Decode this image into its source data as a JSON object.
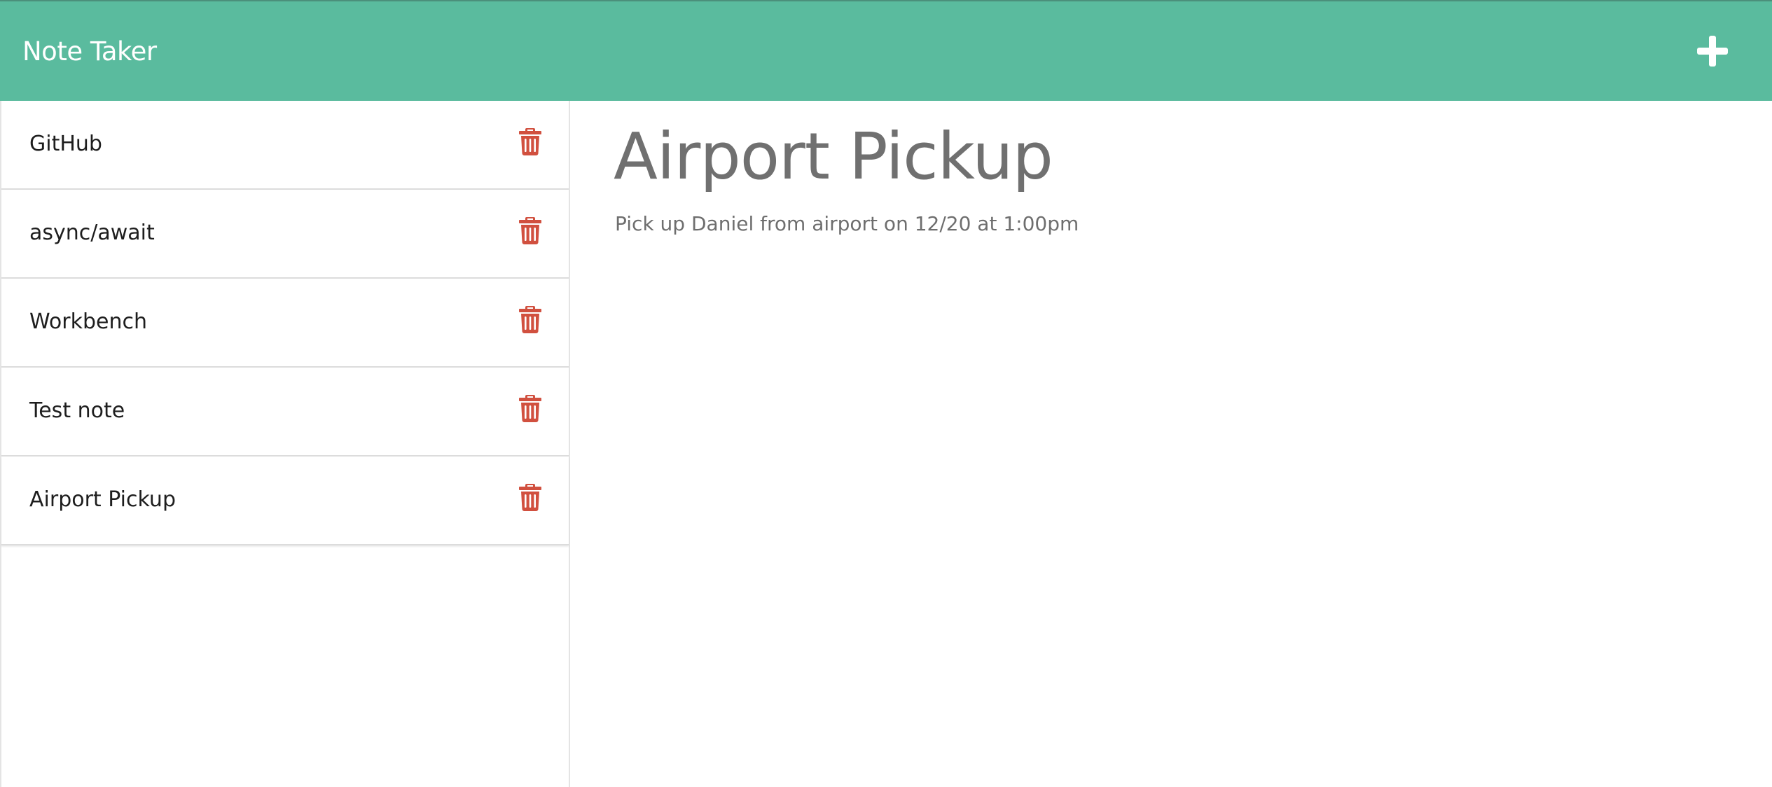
{
  "header": {
    "brand": "Note Taker",
    "new_note_icon": "plus-icon",
    "background_color": "#5abb9e"
  },
  "sidebar": {
    "notes": [
      {
        "title": "GitHub",
        "delete_icon": "trash-icon"
      },
      {
        "title": "async/await",
        "delete_icon": "trash-icon"
      },
      {
        "title": "Workbench",
        "delete_icon": "trash-icon"
      },
      {
        "title": "Test note",
        "delete_icon": "trash-icon"
      },
      {
        "title": "Airport Pickup",
        "delete_icon": "trash-icon"
      }
    ],
    "delete_icon_color": "#d1503f"
  },
  "main": {
    "title": "Airport Pickup",
    "text": "Pick up Daniel from airport on 12/20 at 1:00pm"
  }
}
